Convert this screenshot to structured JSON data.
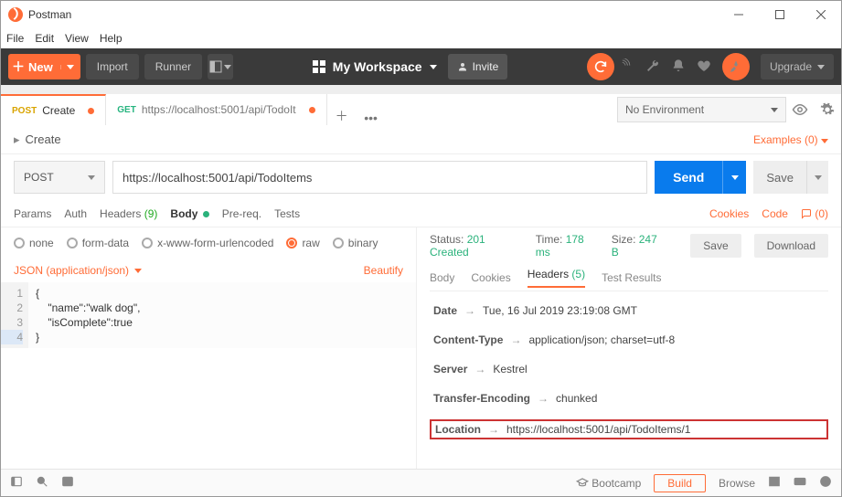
{
  "window": {
    "title": "Postman"
  },
  "menu": {
    "file": "File",
    "edit": "Edit",
    "view": "View",
    "help": "Help"
  },
  "toolbar": {
    "new": "New",
    "import": "Import",
    "runner": "Runner",
    "workspace": "My Workspace",
    "invite": "Invite",
    "upgrade": "Upgrade"
  },
  "tabs": [
    {
      "method": "POST",
      "label": "Create"
    },
    {
      "method": "GET",
      "label": "https://localhost:5001/api/TodoIt"
    }
  ],
  "env": {
    "label": "No Environment"
  },
  "request": {
    "name": "Create",
    "examples": "Examples (0)",
    "method": "POST",
    "url": "https://localhost:5001/api/TodoItems",
    "send": "Send",
    "save": "Save"
  },
  "subtabs": {
    "params": "Params",
    "auth": "Auth",
    "headers": "Headers",
    "headers_count": "(9)",
    "body": "Body",
    "prereq": "Pre-req.",
    "tests": "Tests",
    "cookies": "Cookies",
    "code": "Code",
    "comments": "(0)"
  },
  "bodytypes": {
    "none": "none",
    "formdata": "form-data",
    "urlenc": "x-www-form-urlencoded",
    "raw": "raw",
    "binary": "binary"
  },
  "contentType": "JSON (application/json)",
  "beautify": "Beautify",
  "editor": {
    "lines": [
      "1",
      "2",
      "3",
      "4"
    ],
    "code": "{\n    \"name\":\"walk dog\",\n    \"isComplete\":true\n}"
  },
  "response": {
    "statusLabel": "Status:",
    "status": "201 Created",
    "timeLabel": "Time:",
    "time": "178 ms",
    "sizeLabel": "Size:",
    "size": "247 B",
    "save": "Save",
    "download": "Download",
    "tabs": {
      "body": "Body",
      "cookies": "Cookies",
      "headers": "Headers",
      "headers_count": "(5)",
      "tests": "Test Results"
    },
    "headers": [
      {
        "k": "Date",
        "v": "Tue, 16 Jul 2019 23:19:08 GMT"
      },
      {
        "k": "Content-Type",
        "v": "application/json; charset=utf-8"
      },
      {
        "k": "Server",
        "v": "Kestrel"
      },
      {
        "k": "Transfer-Encoding",
        "v": "chunked"
      },
      {
        "k": "Location",
        "v": "https://localhost:5001/api/TodoItems/1",
        "hl": true
      }
    ]
  },
  "statusbar": {
    "bootcamp": "Bootcamp",
    "build": "Build",
    "browse": "Browse"
  }
}
